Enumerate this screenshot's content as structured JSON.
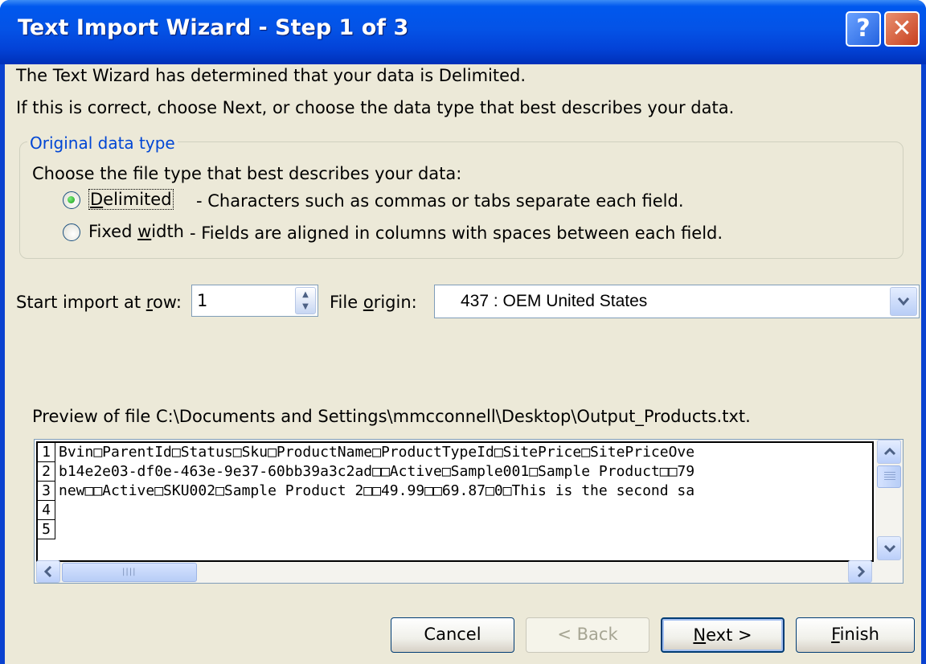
{
  "window": {
    "title": "Text Import Wizard - Step 1 of 3",
    "help_label": "?",
    "close_label": "✕"
  },
  "intro": {
    "line1": "The Text Wizard has determined that your data is Delimited.",
    "line2": "If this is correct, choose Next, or choose the data type that best describes your data."
  },
  "data_type": {
    "group_title": "Original data type",
    "prompt": "Choose the file type that best describes your data:",
    "options": [
      {
        "label_pre": "",
        "label_u": "D",
        "label_post": "elimited",
        "description": "- Characters such as commas or tabs separate each field.",
        "selected": true
      },
      {
        "label_pre": "Fixed ",
        "label_u": "w",
        "label_post": "idth",
        "description": "- Fields are aligned in columns with spaces between each field.",
        "selected": false
      }
    ]
  },
  "import_options": {
    "start_row_label_pre": "Start import at ",
    "start_row_label_u": "r",
    "start_row_label_post": "ow:",
    "start_row_value": "1",
    "file_origin_label_pre": "File ",
    "file_origin_label_u": "o",
    "file_origin_label_post": "rigin:",
    "file_origin_value": "437 : OEM United States"
  },
  "preview": {
    "caption": "Preview of file C:\\Documents and Settings\\mmcconnell\\Desktop\\Output_Products.txt.",
    "lines": [
      {
        "num": "1",
        "text": "Bvin□ParentId□Status□Sku□ProductName□ProductTypeId□SitePrice□SitePriceOve"
      },
      {
        "num": "2",
        "text": "b14e2e03-df0e-463e-9e37-60bb39a3c2ad□□Active□Sample001□Sample Product□□79"
      },
      {
        "num": "3",
        "text": "new□□Active□SKU002□Sample Product 2□□49.99□□69.87□0□This is the second sa"
      },
      {
        "num": "4",
        "text": ""
      },
      {
        "num": "5",
        "text": ""
      }
    ]
  },
  "buttons": {
    "cancel": "Cancel",
    "back": "< Back",
    "next_u": "N",
    "next_post": "ext >",
    "finish_u": "F",
    "finish_post": "inish"
  },
  "colors": {
    "titlebar": "#0453e6",
    "dialog_bg": "#ece9d8",
    "group_title": "#0046d5"
  }
}
